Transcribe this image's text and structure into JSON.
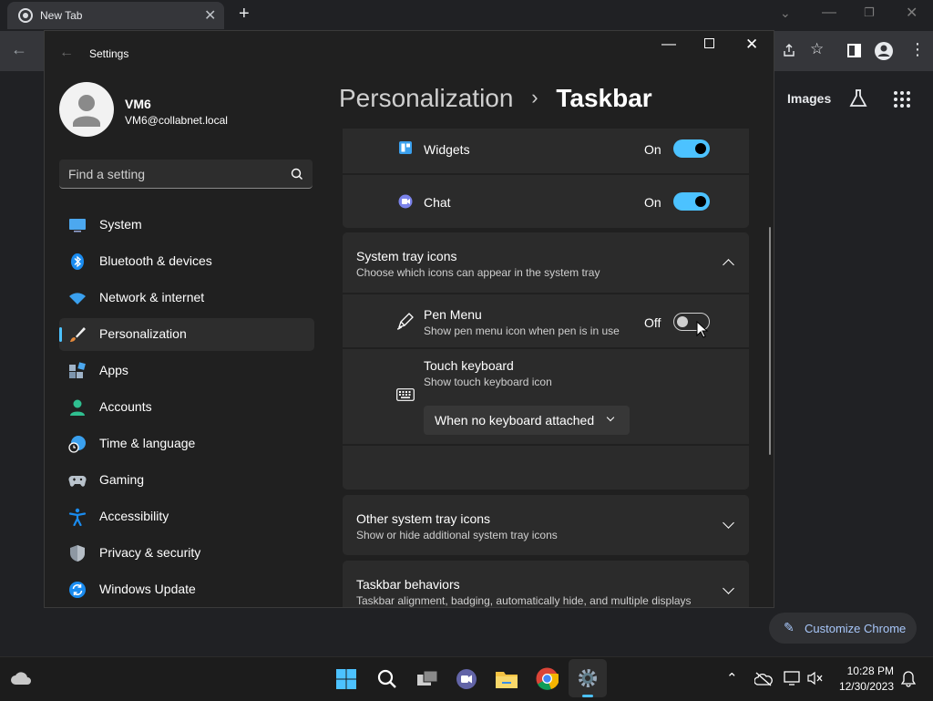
{
  "chrome": {
    "tab_title": "New Tab",
    "images_link": "Images",
    "customize_label": "Customize Chrome"
  },
  "settings": {
    "window_title": "Settings",
    "user": {
      "name": "VM6",
      "email": "VM6@collabnet.local"
    },
    "search_placeholder": "Find a setting",
    "nav": [
      {
        "label": "System",
        "icon": "monitor-icon"
      },
      {
        "label": "Bluetooth & devices",
        "icon": "bluetooth-icon"
      },
      {
        "label": "Network & internet",
        "icon": "wifi-icon"
      },
      {
        "label": "Personalization",
        "icon": "brush-icon"
      },
      {
        "label": "Apps",
        "icon": "apps-icon"
      },
      {
        "label": "Accounts",
        "icon": "person-icon"
      },
      {
        "label": "Time & language",
        "icon": "globe-clock-icon"
      },
      {
        "label": "Gaming",
        "icon": "gamepad-icon"
      },
      {
        "label": "Accessibility",
        "icon": "accessibility-icon"
      },
      {
        "label": "Privacy & security",
        "icon": "shield-icon"
      },
      {
        "label": "Windows Update",
        "icon": "update-icon"
      }
    ],
    "breadcrumb": {
      "parent": "Personalization",
      "sep": "›",
      "current": "Taskbar"
    },
    "rows": {
      "widgets": {
        "label": "Widgets",
        "state": "On"
      },
      "chat": {
        "label": "Chat",
        "state": "On"
      },
      "tray": {
        "title": "System tray icons",
        "desc": "Choose which icons can appear in the system tray"
      },
      "pen": {
        "label": "Pen Menu",
        "desc": "Show pen menu icon when pen is in use",
        "state": "Off"
      },
      "touch": {
        "label": "Touch keyboard",
        "desc": "Show touch keyboard icon",
        "dropdown": "When no keyboard attached"
      },
      "other": {
        "title": "Other system tray icons",
        "desc": "Show or hide additional system tray icons"
      },
      "behaviors": {
        "title": "Taskbar behaviors",
        "desc": "Taskbar alignment, badging, automatically hide, and multiple displays"
      }
    }
  },
  "taskbar": {
    "time": "10:28 PM",
    "date": "12/30/2023"
  },
  "colors": {
    "accent": "#4cc2ff",
    "chrome_link": "#a8c7fa"
  }
}
